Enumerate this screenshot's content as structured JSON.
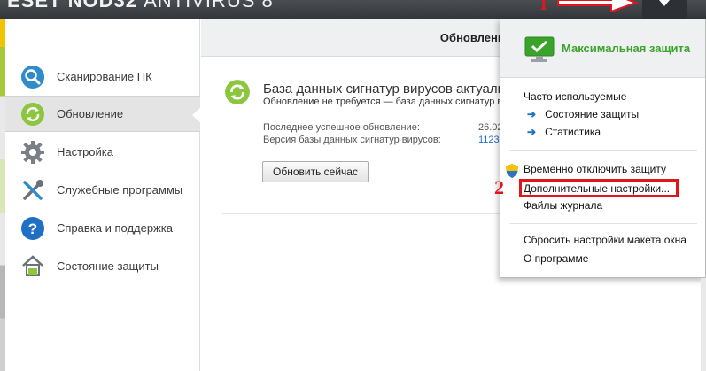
{
  "window": {
    "title_bold": "ESET NOD32",
    "title_light": "ANTIVIRUS 8"
  },
  "annotations": {
    "one": "1",
    "two": "2",
    "color": "#e0161b"
  },
  "sidebar": {
    "items": [
      {
        "label": "Сканирование ПК",
        "icon": "magnifier-icon"
      },
      {
        "label": "Обновление",
        "icon": "update-icon",
        "active": true
      },
      {
        "label": "Настройка",
        "icon": "gear-icon"
      },
      {
        "label": "Служебные программы",
        "icon": "tools-icon"
      },
      {
        "label": "Справка и поддержка",
        "icon": "help-icon"
      },
      {
        "label": "Состояние защиты",
        "icon": "home-icon"
      }
    ]
  },
  "main": {
    "header": "Обновление",
    "status_title": "База данных сигнатур вирусов актуальна",
    "status_sub": "Обновление не требуется — база данных сигнатур вирусов актуальна.",
    "last_update_label": "Последнее успешное обновление:",
    "last_update_value": "26.02",
    "db_version_label": "Версия базы данных сигнатур вирусов:",
    "db_version_value": "1123",
    "update_button": "Обновить сейчас"
  },
  "dropdown": {
    "protection_status": "Максимальная защита",
    "frequently_used": "Часто используемые",
    "sub_items": [
      "Состояние защиты",
      "Статистика"
    ],
    "disable_protection": "Временно отключить защиту",
    "advanced_settings": "Дополнительные настройки...",
    "log_files": "Файлы журнала",
    "reset_layout": "Сбросить настройки макета окна",
    "about": "О программе"
  },
  "colors": {
    "accent_green": "#3aa32a",
    "link_blue": "#1f6fc4",
    "title_bar": "#3a3e42"
  }
}
